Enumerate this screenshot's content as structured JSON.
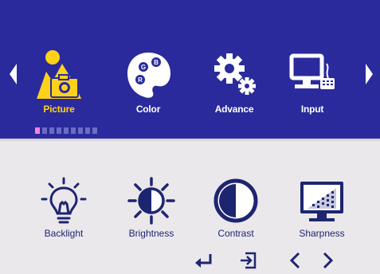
{
  "main_menu": {
    "items": [
      {
        "label": "Picture",
        "icon": "picture-icon",
        "active": true
      },
      {
        "label": "Color",
        "icon": "palette-icon",
        "active": false
      },
      {
        "label": "Advance",
        "icon": "gears-icon",
        "active": false
      },
      {
        "label": "Input",
        "icon": "monitor-keyboard-icon",
        "active": false
      }
    ],
    "palette_letters": [
      "B",
      "G",
      "R"
    ],
    "page_indicator": {
      "total": 9,
      "current": 1
    }
  },
  "sub_menu": {
    "items": [
      {
        "label": "Backlight",
        "icon": "lightbulb-icon"
      },
      {
        "label": "Brightness",
        "icon": "sun-icon"
      },
      {
        "label": "Contrast",
        "icon": "contrast-icon"
      },
      {
        "label": "Sharpness",
        "icon": "sharpness-icon"
      }
    ]
  },
  "controls": [
    {
      "name": "enter",
      "icon": "enter-icon"
    },
    {
      "name": "exit",
      "icon": "exit-icon"
    },
    {
      "name": "left",
      "icon": "chevron-left-icon"
    },
    {
      "name": "right",
      "icon": "chevron-right-icon"
    }
  ],
  "colors": {
    "top_background": "#2a2a9c",
    "bottom_background": "#ebe8ec",
    "active_label": "#ffd21a",
    "icon_navy": "#1e2570"
  }
}
